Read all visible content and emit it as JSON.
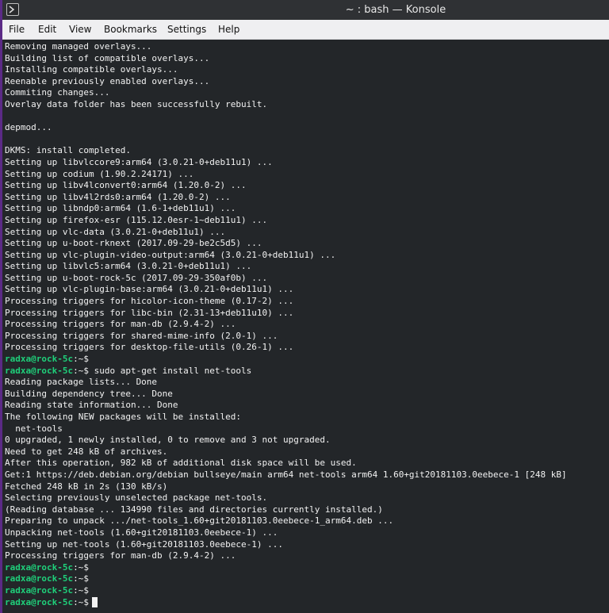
{
  "window": {
    "title": "~ : bash — Konsole",
    "icon": "terminal-icon"
  },
  "menu": [
    "File",
    "Edit",
    "View",
    "Bookmarks",
    "Settings",
    "Help"
  ],
  "prompt": {
    "user": "radxa@rock-5c",
    "path": ":~$"
  },
  "output": [
    "Removing managed overlays...",
    "Building list of compatible overlays...",
    "Installing compatible overlays...",
    "Reenable previously enabled overlays...",
    "Commiting changes...",
    "Overlay data folder has been successfully rebuilt.",
    "",
    "depmod...",
    "",
    "DKMS: install completed.",
    "Setting up libvlccore9:arm64 (3.0.21-0+deb11u1) ...",
    "Setting up codium (1.90.2.24171) ...",
    "Setting up libv4lconvert0:arm64 (1.20.0-2) ...",
    "Setting up libv4l2rds0:arm64 (1.20.0-2) ...",
    "Setting up libndp0:arm64 (1.6-1+deb11u1) ...",
    "Setting up firefox-esr (115.12.0esr-1~deb11u1) ...",
    "Setting up vlc-data (3.0.21-0+deb11u1) ...",
    "Setting up u-boot-rknext (2017.09-29-be2c5d5) ...",
    "Setting up vlc-plugin-video-output:arm64 (3.0.21-0+deb11u1) ...",
    "Setting up libvlc5:arm64 (3.0.21-0+deb11u1) ...",
    "Setting up u-boot-rock-5c (2017.09-29-350af0b) ...",
    "Setting up vlc-plugin-base:arm64 (3.0.21-0+deb11u1) ...",
    "Processing triggers for hicolor-icon-theme (0.17-2) ...",
    "Processing triggers for libc-bin (2.31-13+deb11u10) ...",
    "Processing triggers for man-db (2.9.4-2) ...",
    "Processing triggers for shared-mime-info (2.0-1) ...",
    "Processing triggers for desktop-file-utils (0.26-1) ..."
  ],
  "command1": {
    "empty_prompt": "",
    "command": " sudo apt-get install net-tools"
  },
  "output2": [
    "Reading package lists... Done",
    "Building dependency tree... Done",
    "Reading state information... Done",
    "The following NEW packages will be installed:",
    "  net-tools",
    "0 upgraded, 1 newly installed, 0 to remove and 3 not upgraded.",
    "Need to get 248 kB of archives.",
    "After this operation, 982 kB of additional disk space will be used.",
    "Get:1 https://deb.debian.org/debian bullseye/main arm64 net-tools arm64 1.60+git20181103.0eebece-1 [248 kB]",
    "Fetched 248 kB in 2s (130 kB/s)",
    "Selecting previously unselected package net-tools.",
    "(Reading database ... 134990 files and directories currently installed.)",
    "Preparing to unpack .../net-tools_1.60+git20181103.0eebece-1_arm64.deb ...",
    "Unpacking net-tools (1.60+git20181103.0eebece-1) ...",
    "Setting up net-tools (1.60+git20181103.0eebece-1) ...",
    "Processing triggers for man-db (2.9.4-2) ..."
  ],
  "colors": {
    "background": "#232629",
    "prompt_user": "#1fcf7a",
    "text": "#f2f2f2",
    "accent": "#5b2a86"
  }
}
